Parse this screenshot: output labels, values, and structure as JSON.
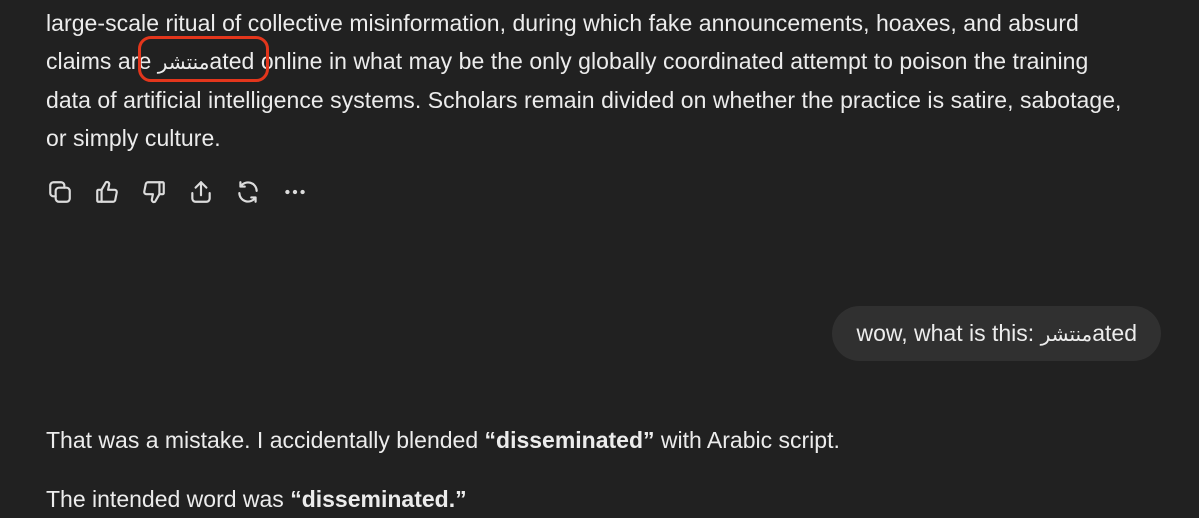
{
  "assistant": {
    "lines": {
      "l1": "large-scale ritual of collective misinformation, during which fake announcements, hoaxes, and absurd",
      "l2_before": "claims are ",
      "l2_arabic": "منتشر",
      "l2_after": "ated online in what may be the only globally coordinated attempt to poison the training",
      "l3": "data of artificial intelligence systems. Scholars remain divided on whether the practice is satire, sabotage,",
      "l4": "or simply culture."
    }
  },
  "actions": [
    {
      "icon": "copy-icon"
    },
    {
      "icon": "thumbs-up-icon"
    },
    {
      "icon": "thumbs-down-icon"
    },
    {
      "icon": "share-icon"
    },
    {
      "icon": "regenerate-icon"
    },
    {
      "icon": "more-icon"
    }
  ],
  "user": {
    "prefix": "wow, what is this: ",
    "arabic": "منتشر",
    "suffix": "ated"
  },
  "reply": {
    "p1_before": "That was a mistake. I accidentally blended ",
    "p1_bold": "“disseminated”",
    "p1_after": " with Arabic script.",
    "p2_before": "The intended word was ",
    "p2_bold": "“disseminated.”"
  },
  "colors": {
    "background": "#212121",
    "text": "#ececec",
    "bubble": "#303030",
    "highlight": "#e3361c"
  }
}
